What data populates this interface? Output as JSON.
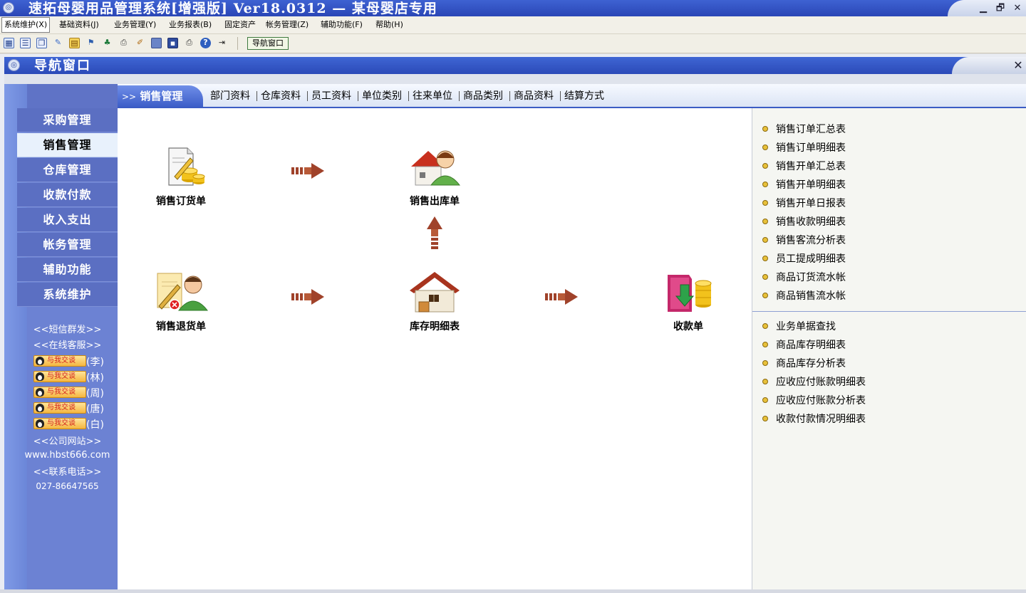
{
  "window": {
    "title": "速拓母婴用品管理系统[增强版] Ver18.0312 — 某母婴店专用",
    "minimize_glyph": "▁",
    "restore_glyph": "🗗",
    "close_glyph": "✕"
  },
  "menubar": {
    "items": [
      {
        "label": "系统维护(X)"
      },
      {
        "label": "基础资料(J)"
      },
      {
        "label": "业务管理(Y)"
      },
      {
        "label": "业务报表(B)"
      },
      {
        "label": "固定资产"
      },
      {
        "label": "帐务管理(Z)"
      },
      {
        "label": "辅助功能(F)"
      },
      {
        "label": "帮助(H)"
      }
    ]
  },
  "toolbar": {
    "icons": [
      "grid-icon",
      "list-icon",
      "windows-icon",
      "chat-icon",
      "chart-icon",
      "users-icon",
      "tree-icon",
      "print-preview-icon",
      "wrench-icon",
      "monitor-icon",
      "save-icon",
      "printer-icon",
      "help-icon",
      "exit-icon"
    ],
    "nav_button_label": "导航窗口"
  },
  "inner_window": {
    "title": "导航窗口",
    "close_glyph": "✕"
  },
  "sidebar": {
    "items": [
      {
        "label": "采购管理"
      },
      {
        "label": "销售管理"
      },
      {
        "label": "仓库管理"
      },
      {
        "label": "收款付款"
      },
      {
        "label": "收入支出"
      },
      {
        "label": "帐务管理"
      },
      {
        "label": "辅助功能"
      },
      {
        "label": "系统维护"
      }
    ],
    "sms": "<<短信群发>>",
    "online_service": "<<在线客服>>",
    "qq_badge_label": "与我交谈",
    "qq_contacts": [
      "(李)",
      "(林)",
      "(周)",
      "(唐)",
      "(白)"
    ],
    "company_site_label": "<<公司网站>>",
    "website": "www.hbst666.com",
    "phone_label": "<<联系电话>>",
    "phone": "027-86647565"
  },
  "tabbar": {
    "active_prefix": ">>",
    "active_label": "销售管理",
    "links": [
      "部门资料",
      "仓库资料",
      "员工资料",
      "单位类别",
      "往来单位",
      "商品类别",
      "商品资料",
      "结算方式"
    ]
  },
  "diagram": {
    "nodes": {
      "sales_order": "销售订货单",
      "sales_outbound": "销售出库单",
      "sales_return": "销售退货单",
      "inventory_detail": "库存明细表",
      "receipt": "收款单"
    }
  },
  "reports": {
    "group1": [
      "销售订单汇总表",
      "销售订单明细表",
      "销售开单汇总表",
      "销售开单明细表",
      "销售开单日报表",
      "销售收款明细表",
      "销售客流分析表",
      "员工提成明细表",
      "商品订货流水帐",
      "商品销售流水帐"
    ],
    "group2": [
      "业务单据查找",
      "商品库存明细表",
      "商品库存分析表",
      "应收应付账款明细表",
      "应收应付账款分析表",
      "收款付款情况明细表"
    ]
  },
  "colors": {
    "titlebar": "#2a46b6",
    "sidebar": "#5b6fc2",
    "sidebar_active": "#e8f1fc",
    "arrow": "#a0422a",
    "bullet": "#e8c13a"
  }
}
